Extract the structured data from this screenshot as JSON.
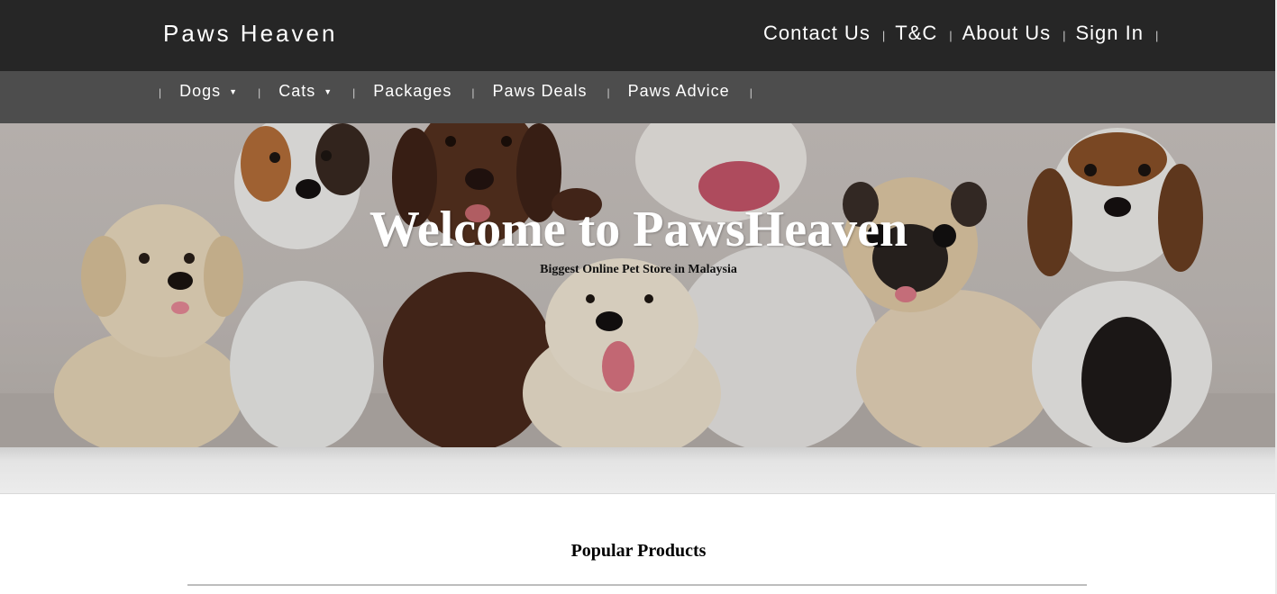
{
  "header": {
    "brand": "Paws Heaven",
    "links": [
      "Contact Us",
      "T&C",
      "About Us",
      "Sign In"
    ],
    "separator": "|"
  },
  "nav": {
    "items": [
      {
        "label": "Dogs",
        "dropdown": true
      },
      {
        "label": "Cats",
        "dropdown": true
      },
      {
        "label": "Packages",
        "dropdown": false
      },
      {
        "label": "Paws Deals",
        "dropdown": false
      },
      {
        "label": "Paws Advice",
        "dropdown": false
      }
    ],
    "caret": "▼",
    "separator": "|"
  },
  "hero": {
    "title": "Welcome to PawsHeaven",
    "subtitle": "Biggest Online Pet Store in Malaysia",
    "image": "puppies-photo"
  },
  "popular": {
    "title": "Popular Products"
  },
  "colors": {
    "topbar": "#262626",
    "navbar": "#4d4d4d",
    "accent_text": "#ffffff"
  }
}
